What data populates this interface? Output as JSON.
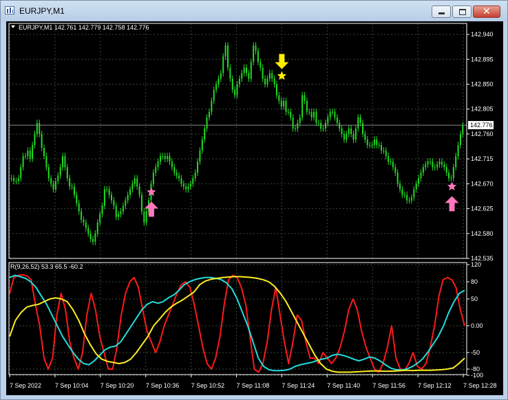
{
  "window": {
    "title": "EURJPY,M1",
    "icon": "chart-window-icon",
    "controls": [
      "minimize-icon",
      "maximize-icon",
      "close-icon"
    ]
  },
  "colors": {
    "background": "#000000",
    "candles": "#22dd22",
    "grid": "#3a4a3a",
    "indicator_red": "#ff1a1a",
    "indicator_cyan": "#22dddd",
    "indicator_yellow": "#ffee22",
    "sell_signal": "#ffee00",
    "buy_signal": "#ff77bb"
  },
  "main_chart": {
    "info": "EURJPY,M1  142.761 142.779 142.758 142.776",
    "current_price": "142.776",
    "price_labels": [
      "142.940",
      "142.895",
      "142.850",
      "142.805",
      "142.760",
      "142.715",
      "142.670",
      "142.625",
      "142.580",
      "142.535"
    ]
  },
  "indicator": {
    "info": "R(9,26,52) 53.3 65.5 -60.2",
    "labels": [
      "120",
      "80",
      "50",
      "0.00",
      "-50",
      "-80",
      "-100"
    ]
  },
  "time_labels": [
    "7 Sep 2022",
    "7 Sep 10:04",
    "7 Sep 10:20",
    "7 Sep 10:36",
    "7 Sep 10:52",
    "7 Sep 11:08",
    "7 Sep 11:24",
    "7 Sep 11:40",
    "7 Sep 11:56",
    "7 Sep 12:12",
    "7 Sep 12:28"
  ],
  "chart_data": {
    "type": "candlestick",
    "symbol": "EURJPY",
    "timeframe": "M1",
    "ylim": [
      142.535,
      142.96
    ],
    "last_bar": {
      "open": 142.761,
      "high": 142.779,
      "low": 142.758,
      "close": 142.776
    },
    "close": [
      142.68,
      142.675,
      142.675,
      142.68,
      142.7,
      142.72,
      142.72,
      142.73,
      142.715,
      142.74,
      142.76,
      142.78,
      142.76,
      142.735,
      142.72,
      142.7,
      142.68,
      142.67,
      142.66,
      142.675,
      142.685,
      142.7,
      142.72,
      142.7,
      142.68,
      142.665,
      142.665,
      142.65,
      142.635,
      142.62,
      142.605,
      142.6,
      142.59,
      142.58,
      142.57,
      142.565,
      142.58,
      142.6,
      142.615,
      142.63,
      142.66,
      142.66,
      142.65,
      142.64,
      142.63,
      142.61,
      142.615,
      142.62,
      142.63,
      142.64,
      142.65,
      142.66,
      142.67,
      142.68,
      142.665,
      142.65,
      142.62,
      142.6,
      142.62,
      142.64,
      142.67,
      142.69,
      142.7,
      142.71,
      142.72,
      142.72,
      142.715,
      142.72,
      142.71,
      142.7,
      142.69,
      142.685,
      142.68,
      142.67,
      142.665,
      142.66,
      142.665,
      142.67,
      142.68,
      142.69,
      142.71,
      142.73,
      142.75,
      142.77,
      142.79,
      142.8,
      142.82,
      142.84,
      142.85,
      142.86,
      142.87,
      142.9,
      142.92,
      142.88,
      142.86,
      142.84,
      142.83,
      142.85,
      142.86,
      142.87,
      142.88,
      142.87,
      142.86,
      142.89,
      142.92,
      142.91,
      142.89,
      142.88,
      142.86,
      142.85,
      142.86,
      142.87,
      142.86,
      142.85,
      142.83,
      142.82,
      142.81,
      142.82,
      142.8,
      142.8,
      142.79,
      142.77,
      142.77,
      142.78,
      142.79,
      142.83,
      142.82,
      142.8,
      142.8,
      142.79,
      142.8,
      142.78,
      142.78,
      142.77,
      142.77,
      142.78,
      142.79,
      142.8,
      142.8,
      142.79,
      142.78,
      142.77,
      142.76,
      142.75,
      142.76,
      142.77,
      142.76,
      142.75,
      142.77,
      142.79,
      142.78,
      142.76,
      142.75,
      142.74,
      142.74,
      142.74,
      142.75,
      142.74,
      142.74,
      142.73,
      142.73,
      142.72,
      142.71,
      142.71,
      142.7,
      142.69,
      142.67,
      142.66,
      142.65,
      142.65,
      142.64,
      142.64,
      142.645,
      142.66,
      142.67,
      142.68,
      142.69,
      142.7,
      142.705,
      142.71,
      142.71,
      142.7,
      142.7,
      142.705,
      142.71,
      142.705,
      142.7,
      142.69,
      142.68,
      142.68,
      142.7,
      142.72,
      142.74,
      142.76,
      142.776
    ],
    "indicator_series": [
      {
        "name": "R(9)",
        "color": "#ff1a1a",
        "values": [
          60,
          90,
          95,
          96,
          94,
          85,
          40,
          0,
          -60,
          -80,
          -60,
          20,
          60,
          30,
          -30,
          -60,
          -80,
          -50,
          20,
          60,
          30,
          -20,
          -50,
          -80,
          -80,
          -40,
          20,
          60,
          80,
          90,
          70,
          30,
          -10,
          -30,
          -50,
          -30,
          0,
          20,
          40,
          60,
          75,
          80,
          70,
          40,
          0,
          -40,
          -70,
          -80,
          -60,
          -20,
          40,
          85,
          95,
          90,
          70,
          40,
          -20,
          -80,
          -90,
          -70,
          -30,
          30,
          70,
          20,
          -30,
          -70,
          -30,
          20,
          10,
          -30,
          -60,
          -60,
          -70,
          -50,
          -60,
          -70,
          -60,
          -40,
          -10,
          30,
          50,
          30,
          -10,
          -40,
          -60,
          -80,
          -90,
          -70,
          -40,
          0,
          -60,
          -80,
          -85,
          -70,
          -50,
          -75,
          -80,
          -70,
          -40,
          0,
          55,
          85,
          90,
          85,
          70,
          30,
          0
        ]
      },
      {
        "name": "R(26)",
        "color": "#22dddd",
        "values": [
          90,
          95,
          92,
          88,
          80,
          70,
          55,
          40,
          20,
          0,
          -20,
          -35,
          -50,
          -62,
          -70,
          -72,
          -65,
          -55,
          -45,
          -40,
          -38,
          -30,
          -15,
          0,
          15,
          30,
          40,
          45,
          42,
          45,
          52,
          57,
          65,
          75,
          80,
          85,
          88,
          90,
          90,
          88,
          85,
          78,
          68,
          50,
          25,
          0,
          -30,
          -60,
          -75,
          -82,
          -85,
          -85,
          -84,
          -80,
          -75,
          -72,
          -70,
          -68,
          -65,
          -62,
          -60,
          -55,
          -53,
          -55,
          -58,
          -62,
          -65,
          -62,
          -58,
          -60,
          -65,
          -72,
          -78,
          -82,
          -83,
          -80,
          -76,
          -70,
          -62,
          -50,
          -35,
          -20,
          0,
          25,
          45,
          60,
          65
        ]
      },
      {
        "name": "R(52)",
        "color": "#ffee22",
        "values": [
          -20,
          10,
          25,
          35,
          38,
          40,
          45,
          50,
          52,
          50,
          45,
          30,
          10,
          -15,
          -35,
          -52,
          -62,
          -66,
          -68,
          -70,
          -68,
          -62,
          -50,
          -35,
          -20,
          0,
          12,
          25,
          35,
          42,
          48,
          55,
          62,
          75,
          82,
          86,
          88,
          90,
          91,
          92,
          92,
          91,
          90,
          88,
          85,
          80,
          72,
          60,
          45,
          25,
          5,
          -15,
          -35,
          -55,
          -70,
          -80,
          -87,
          -90,
          -90,
          -90,
          -89,
          -88,
          -87,
          -86,
          -86,
          -87,
          -87,
          -86,
          -85,
          -84,
          -85,
          -84,
          -84,
          -84,
          -83,
          -82,
          -80,
          -78,
          -70,
          -60
        ]
      }
    ],
    "signals": [
      {
        "type": "buy",
        "time": "7 Sep 10:38",
        "price": 142.655,
        "marker": "pink-star-and-up-arrow"
      },
      {
        "type": "sell",
        "time": "7 Sep 11:24",
        "price": 142.865,
        "marker": "yellow-star-and-down-arrow"
      },
      {
        "type": "buy",
        "time": "7 Sep 12:24",
        "price": 142.665,
        "marker": "pink-star-and-up-arrow"
      }
    ]
  }
}
